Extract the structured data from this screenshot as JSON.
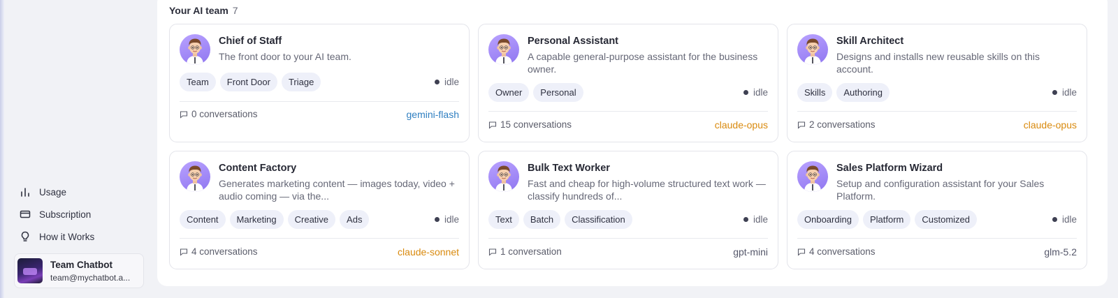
{
  "sidebar": {
    "nav": [
      {
        "label": "Usage",
        "icon": "bar-chart-icon"
      },
      {
        "label": "Subscription",
        "icon": "credit-card-icon"
      },
      {
        "label": "How it Works",
        "icon": "lightbulb-icon"
      }
    ],
    "account": {
      "name": "Team Chatbot",
      "email": "team@mychatbot.a..."
    }
  },
  "section": {
    "title": "Your AI team",
    "count": "7"
  },
  "colors": {
    "gemini": "#2f7fc1",
    "claude": "#d98a0e",
    "neutral": "#55576a",
    "avatar_bg": "#9b84f5"
  },
  "cards": [
    {
      "title": "Chief of Staff",
      "description": "The front door to your AI team.",
      "tags": [
        "Team",
        "Front Door",
        "Triage"
      ],
      "status": "idle",
      "conversations": "0 conversations",
      "model": "gemini-flash"
    },
    {
      "title": "Personal Assistant",
      "description": "A capable general-purpose assistant for the business owner.",
      "tags": [
        "Owner",
        "Personal"
      ],
      "status": "idle",
      "conversations": "15 conversations",
      "model": "claude-opus"
    },
    {
      "title": "Skill Architect",
      "description": "Designs and installs new reusable skills on this account.",
      "tags": [
        "Skills",
        "Authoring"
      ],
      "status": "idle",
      "conversations": "2 conversations",
      "model": "claude-opus"
    },
    {
      "title": "Content Factory",
      "description": "Generates marketing content — images today, video + audio coming — via the...",
      "tags": [
        "Content",
        "Marketing",
        "Creative",
        "Ads"
      ],
      "status": "idle",
      "conversations": "4 conversations",
      "model": "claude-sonnet"
    },
    {
      "title": "Bulk Text Worker",
      "description": "Fast and cheap for high-volume structured text work — classify hundreds of...",
      "tags": [
        "Text",
        "Batch",
        "Classification"
      ],
      "status": "idle",
      "conversations": "1 conversation",
      "model": "gpt-mini"
    },
    {
      "title": "Sales Platform Wizard",
      "description": "Setup and configuration assistant for your Sales Platform.",
      "tags": [
        "Onboarding",
        "Platform",
        "Customized"
      ],
      "status": "idle",
      "conversations": "4 conversations",
      "model": "glm-5.2"
    }
  ]
}
